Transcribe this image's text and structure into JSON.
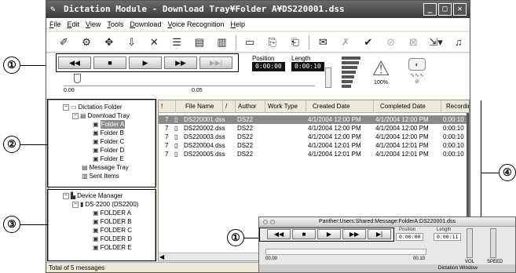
{
  "window": {
    "title": "Dictation Module - Download Tray¥Folder A¥DS220001.dss",
    "minimize": "_",
    "maximize": "□",
    "close": "✕"
  },
  "menu": [
    "File",
    "Edit",
    "View",
    "Tools",
    "Download",
    "Voice Recognition",
    "Help"
  ],
  "toolbar_icons": [
    "dictation-icon",
    "settings-icon",
    "move-icon",
    "download-icon",
    "delete-icon",
    "properties-icon",
    "send-icon",
    "receive-icon",
    "folder-icon",
    "import-icon",
    "template-icon",
    "mail-icon",
    "disabled-icon",
    "check-icon",
    "cancel-icon",
    "blocked-icon",
    "export-icon",
    "voice-icon"
  ],
  "transport": {
    "rewind": "◀◀",
    "stop": "■",
    "play": "▶",
    "fast_forward": "▶▶",
    "end": "▶▶|",
    "position_label": "Position",
    "position_value": "0:00:00",
    "length_label": "Length",
    "length_value": "0:00:10",
    "scale_start": "0.00",
    "scale_mid": "0.05",
    "speed_value": "100%",
    "progress": 0.0
  },
  "tree": {
    "dictation_folder": "Dictation Folder",
    "download_tray": "Download Tray",
    "folders": [
      "Folder A",
      "Folder B",
      "Folder C",
      "Folder D",
      "Folder E"
    ],
    "message_tray": "Message Tray",
    "sent_items": "Sent Items",
    "device_manager": "Device Manager",
    "device": "DS-2200 (DS2200)",
    "device_folders": [
      "FOLDER A",
      "FOLDER B",
      "FOLDER C",
      "FOLDER D",
      "FOLDER E"
    ]
  },
  "list": {
    "headers": [
      "!",
      "File Name",
      "/",
      "Author",
      "Work Type",
      "Created Date",
      "Completed Date",
      "Recordin"
    ],
    "rows": [
      {
        "priority": "7",
        "name": "DS220001.dss",
        "author": "DS22",
        "work": "",
        "created": "4/1/2004 12:00 PM",
        "completed": "4/1/2004 12:00 PM",
        "length": "0:00:10"
      },
      {
        "priority": "7",
        "name": "DS220002.dss",
        "author": "DS22",
        "work": "",
        "created": "4/1/2004 12:00 PM",
        "completed": "4/1/2004 12:00 PM",
        "length": "0:00:10"
      },
      {
        "priority": "7",
        "name": "DS220003.dss",
        "author": "DS22",
        "work": "",
        "created": "4/1/2004 12:00 PM",
        "completed": "4/1/2004 12:00 PM",
        "length": "0:00:10"
      },
      {
        "priority": "7",
        "name": "DS220004.dss",
        "author": "DS22",
        "work": "",
        "created": "4/1/2004 12:01 PM",
        "completed": "4/1/2004 12:01 PM",
        "length": "0:00:10"
      },
      {
        "priority": "7",
        "name": "DS220005.dss",
        "author": "DS22",
        "work": "",
        "created": "4/1/2004 12:01 PM",
        "completed": "4/1/2004 12:01 PM",
        "length": "0:00:10"
      }
    ]
  },
  "status": "Total of 5 messages",
  "callouts": [
    "①",
    "②",
    "③",
    "④",
    "①"
  ],
  "mac": {
    "title": "Panther:Users:Shared:Message:FolderA:DS220001.dss",
    "rewind": "◀◀",
    "stop": "■",
    "play": "▶",
    "fast_forward": "▶▶",
    "end": "▶|",
    "position_label": "Position",
    "position_value": "0:00:00",
    "length_label": "Length",
    "length_value": "0:00:11",
    "scale_start": "00.00",
    "scale_end": "00.10",
    "vol_label": "VOL",
    "speed_label": "SPEED",
    "footer": "Dictation Window"
  }
}
